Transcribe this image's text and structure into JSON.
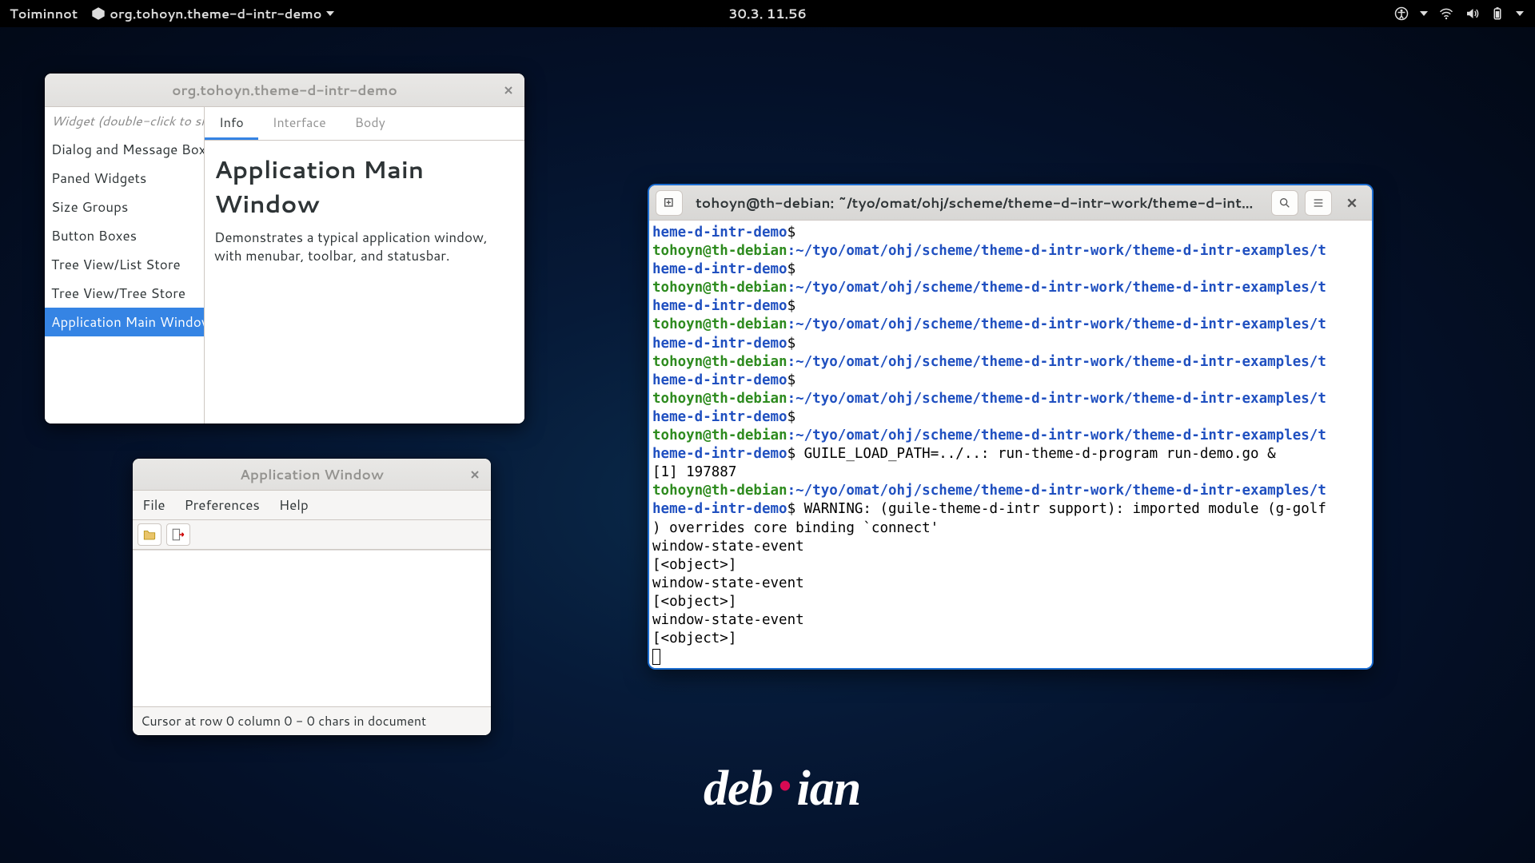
{
  "topbar": {
    "activities": "Toiminnot",
    "app_name": "org.tohoyn.theme-d-intr-demo",
    "clock": "30.3.  11.56"
  },
  "demo": {
    "title": "org.tohoyn.theme-d-intr-demo",
    "sidebar_header": "Widget (double-click to show)",
    "items": [
      "Dialog and Message Boxes",
      "Paned Widgets",
      "Size Groups",
      "Button Boxes",
      "Tree View/List Store",
      "Tree View/Tree Store",
      "Application Main Window"
    ],
    "selected_index": 6,
    "tabs": {
      "info": "Info",
      "interface": "Interface",
      "body": "Body"
    },
    "heading": "Application Main Window",
    "description": "Demonstrates a typical application window, with menubar, toolbar, and statusbar."
  },
  "appwin": {
    "title": "Application Window",
    "menus": {
      "file": "File",
      "prefs": "Preferences",
      "help": "Help"
    },
    "status": "Cursor at row 0 column 0 - 0 chars in document"
  },
  "terminal": {
    "title": "tohoyn@th-debian: ~/tyo/omat/ohj/scheme/theme-d-intr-work/theme-d-intr-e…",
    "user_host": "tohoyn@th-debian",
    "path_long": ":~/tyo/omat/ohj/scheme/theme-d-intr-work/theme-d-intr-examples/t",
    "dir_tail": "heme-d-intr-demo",
    "prompt_char": "$",
    "cmd": "GUILE_LOAD_PATH=../..: run-theme-d-program run-demo.go &",
    "job": "[1] 197887",
    "warn1": "WARNING: (guile-theme-d-intr support): imported module (g-golf",
    "warn2": ") overrides core binding `connect'",
    "event": "window-state-event",
    "obj": "[<object>]"
  },
  "desktop": {
    "debian_a": "deb",
    "debian_b": "ian"
  }
}
